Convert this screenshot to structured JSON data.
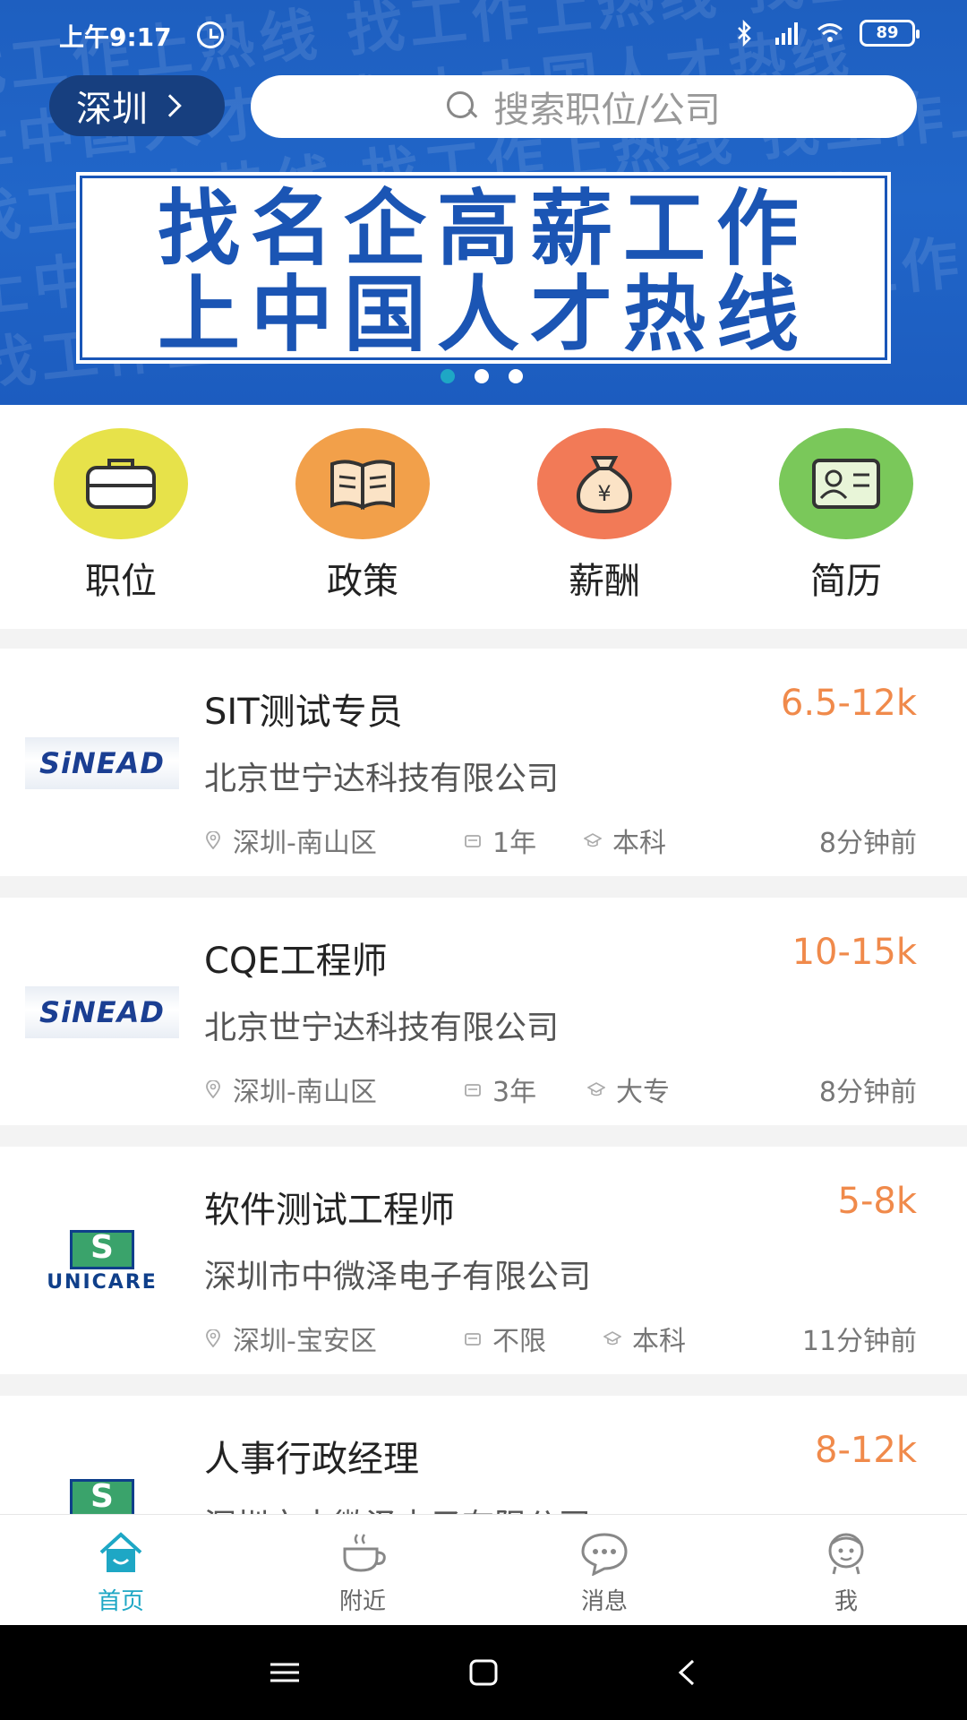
{
  "status_bar": {
    "time": "上午9:17",
    "battery": "89"
  },
  "header": {
    "city": "深圳",
    "search_placeholder": "搜索职位/公司"
  },
  "banner": {
    "line1": "找名企高薪工作",
    "line2": "上中国人才热线"
  },
  "categories": [
    {
      "label": "职位",
      "icon": "briefcase-icon",
      "color": "#e7e24a"
    },
    {
      "label": "政策",
      "icon": "book-icon",
      "color": "#f2a04a"
    },
    {
      "label": "薪酬",
      "icon": "money-bag-icon",
      "color": "#f27a57"
    },
    {
      "label": "简历",
      "icon": "id-card-icon",
      "color": "#7ac85a"
    }
  ],
  "jobs": [
    {
      "title": "SIT测试专员",
      "salary": "6.5-12k",
      "company": "北京世宁达科技有限公司",
      "location": "深圳-南山区",
      "experience": "1年",
      "education": "本科",
      "posted": "8分钟前",
      "logo_text": "SiNEAD"
    },
    {
      "title": "CQE工程师",
      "salary": "10-15k",
      "company": "北京世宁达科技有限公司",
      "location": "深圳-南山区",
      "experience": "3年",
      "education": "大专",
      "posted": "8分钟前",
      "logo_text": "SiNEAD"
    },
    {
      "title": "软件测试工程师",
      "salary": "5-8k",
      "company": "深圳市中微泽电子有限公司",
      "location": "深圳-宝安区",
      "experience": "不限",
      "education": "本科",
      "posted": "11分钟前",
      "logo_text": "UNICARE"
    },
    {
      "title": "人事行政经理",
      "salary": "8-12k",
      "company": "深圳市中微泽电子有限公司"
    }
  ],
  "bottom_nav": [
    {
      "label": "首页",
      "icon": "home-icon",
      "active": true
    },
    {
      "label": "附近",
      "icon": "coffee-cup-icon"
    },
    {
      "label": "消息",
      "icon": "chat-bubble-icon"
    },
    {
      "label": "我",
      "icon": "profile-face-icon"
    }
  ],
  "colors": {
    "accent": "#1ea7c5",
    "salary": "#f08a4b",
    "banner_blue": "#1e5fc0"
  }
}
